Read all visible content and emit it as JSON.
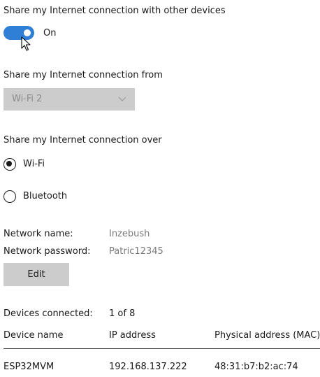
{
  "sharing": {
    "title": "Share my Internet connection with other devices",
    "toggle_state": "On",
    "toggle_on": true
  },
  "share_from": {
    "label": "Share my Internet connection from",
    "selected": "Wi-Fi 2",
    "enabled": false
  },
  "share_over": {
    "label": "Share my Internet connection over",
    "options": [
      {
        "label": "Wi-Fi",
        "selected": true
      },
      {
        "label": "Bluetooth",
        "selected": false
      }
    ]
  },
  "network": {
    "name_label": "Network name:",
    "name_value": "Inzebush",
    "password_label": "Network password:",
    "password_value": "Patric12345",
    "edit_label": "Edit"
  },
  "devices": {
    "connected_label": "Devices connected:",
    "connected_value": "1 of 8",
    "columns": [
      "Device name",
      "IP address",
      "Physical address (MAC)"
    ],
    "rows": [
      [
        "ESP32MVM",
        "192.168.137.222",
        "48:31:b7:b2:ac:74"
      ]
    ]
  },
  "colors": {
    "accent": "#2f7fd6",
    "disabled_bg": "#cccccc"
  }
}
